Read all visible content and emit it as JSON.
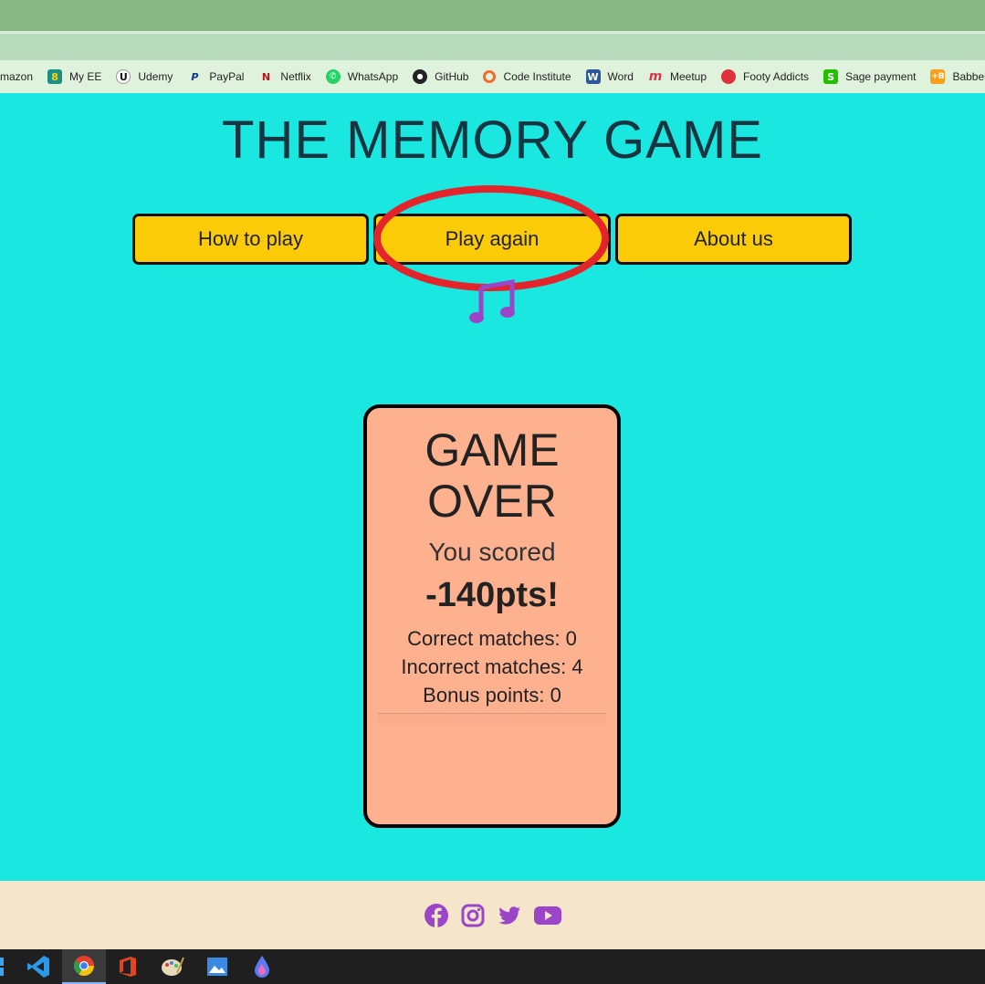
{
  "browser": {
    "bookmarks": [
      {
        "label": "mazon",
        "icon": "amazon-icon",
        "color": "#ff9900",
        "glyph": ""
      },
      {
        "label": "My EE",
        "icon": "ee-icon",
        "color": "#1d8f84",
        "glyph": "8"
      },
      {
        "label": "Udemy",
        "icon": "udemy-icon",
        "color": "#ffffff",
        "glyph": "U"
      },
      {
        "label": "PayPal",
        "icon": "paypal-icon",
        "color": "#ffffff",
        "glyph": "P"
      },
      {
        "label": "Netflix",
        "icon": "netflix-icon",
        "color": "#ffffff",
        "glyph": "N"
      },
      {
        "label": "WhatsApp",
        "icon": "whatsapp-icon",
        "color": "#25d366",
        "glyph": "✆"
      },
      {
        "label": "GitHub",
        "icon": "github-icon",
        "color": "#222222",
        "glyph": "●"
      },
      {
        "label": "Code Institute",
        "icon": "code-institute-icon",
        "color": "#ffffff",
        "glyph": "◯"
      },
      {
        "label": "Word",
        "icon": "word-icon",
        "color": "#2b579a",
        "glyph": "W"
      },
      {
        "label": "Meetup",
        "icon": "meetup-icon",
        "color": "#ffffff",
        "glyph": "m"
      },
      {
        "label": "Footy Addicts",
        "icon": "footy-addicts-icon",
        "color": "#e0303a",
        "glyph": "●"
      },
      {
        "label": "Sage payment",
        "icon": "sage-icon",
        "color": "#20c000",
        "glyph": "S"
      },
      {
        "label": "Babbel",
        "icon": "babbel-icon",
        "color": "#f7a01a",
        "glyph": "+B"
      }
    ]
  },
  "page": {
    "title": "THE MEMORY GAME",
    "nav": {
      "how_to_play": "How to play",
      "play_again": "Play again",
      "about_us": "About us"
    },
    "music_icon": "music-notes-icon"
  },
  "game_over": {
    "title_line1": "GAME",
    "title_line2": "OVER",
    "score_label": "You scored",
    "score_value": "-140pts!",
    "correct_matches": "Correct matches: 0",
    "incorrect_matches": "Incorrect matches: 4",
    "bonus_points": "Bonus points: 0"
  },
  "footer": {
    "social_icons": [
      "facebook-icon",
      "instagram-icon",
      "twitter-icon",
      "youtube-icon"
    ]
  },
  "colors": {
    "background": "#1ae8e0",
    "button": "#fbcb08",
    "card": "#feb18f",
    "footer": "#f5e6cb",
    "accent_purple": "#9b45c9",
    "annotation_red": "#e3242b"
  },
  "taskbar": {
    "apps": [
      "windows-icon",
      "vscode-icon",
      "chrome-icon",
      "office-icon",
      "paint-icon",
      "photos-icon",
      "paint3d-icon"
    ]
  }
}
